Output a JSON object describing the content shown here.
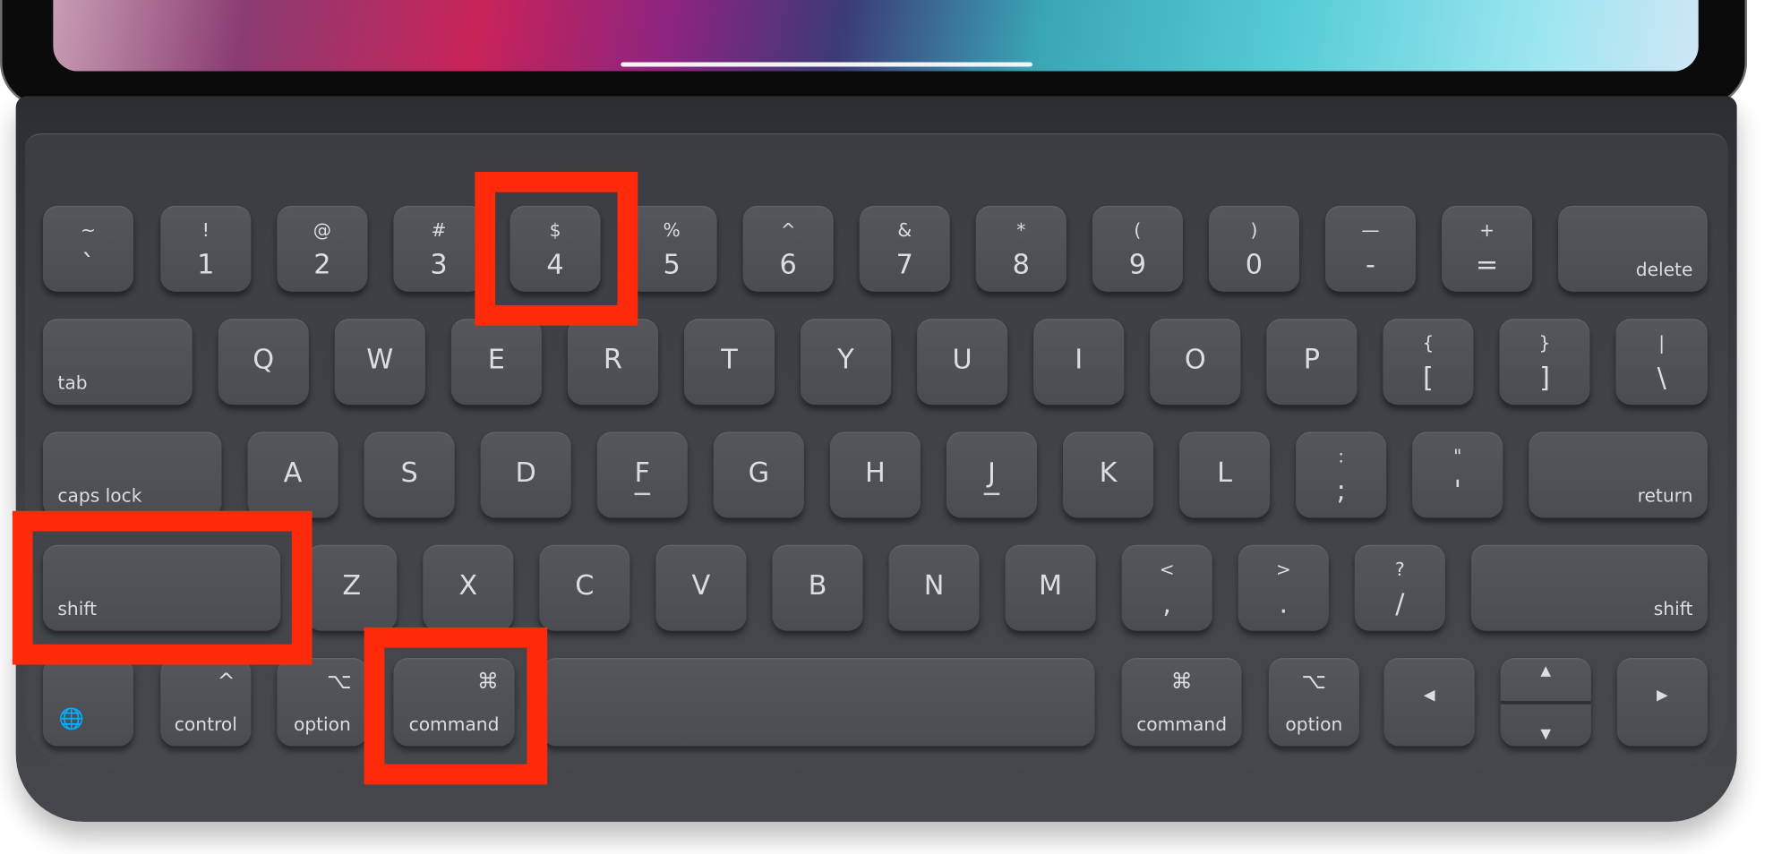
{
  "keyboard": {
    "rows": [
      [
        {
          "top": "~",
          "bot": "`"
        },
        {
          "top": "!",
          "bot": "1"
        },
        {
          "top": "@",
          "bot": "2"
        },
        {
          "top": "#",
          "bot": "3"
        },
        {
          "top": "$",
          "bot": "4"
        },
        {
          "top": "%",
          "bot": "5"
        },
        {
          "top": "^",
          "bot": "6"
        },
        {
          "top": "&",
          "bot": "7"
        },
        {
          "top": "*",
          "bot": "8"
        },
        {
          "top": "(",
          "bot": "9"
        },
        {
          "top": ")",
          "bot": "0"
        },
        {
          "top": "—",
          "bot": "-"
        },
        {
          "top": "+",
          "bot": "="
        },
        {
          "word_right": "delete"
        }
      ],
      [
        {
          "word_left": "tab"
        },
        {
          "single": "Q"
        },
        {
          "single": "W"
        },
        {
          "single": "E"
        },
        {
          "single": "R"
        },
        {
          "single": "T"
        },
        {
          "single": "Y"
        },
        {
          "single": "U"
        },
        {
          "single": "I"
        },
        {
          "single": "O"
        },
        {
          "single": "P"
        },
        {
          "top": "{",
          "bot": "["
        },
        {
          "top": "}",
          "bot": "]"
        },
        {
          "top": "|",
          "bot": "\\"
        }
      ],
      [
        {
          "word_left": "caps lock"
        },
        {
          "single": "A"
        },
        {
          "single": "S"
        },
        {
          "single": "D"
        },
        {
          "single": "F",
          "underline": true
        },
        {
          "single": "G"
        },
        {
          "single": "H"
        },
        {
          "single": "J",
          "underline": true
        },
        {
          "single": "K"
        },
        {
          "single": "L"
        },
        {
          "top": ":",
          "bot": ";"
        },
        {
          "top": "\"",
          "bot": "'"
        },
        {
          "word_right": "return"
        }
      ],
      [
        {
          "word_left": "shift"
        },
        {
          "single": "Z"
        },
        {
          "single": "X"
        },
        {
          "single": "C"
        },
        {
          "single": "V"
        },
        {
          "single": "B"
        },
        {
          "single": "N"
        },
        {
          "single": "M"
        },
        {
          "top": "<",
          "bot": ","
        },
        {
          "top": ">",
          "bot": "."
        },
        {
          "top": "?",
          "bot": "/"
        },
        {
          "word_right": "shift"
        }
      ],
      [
        {
          "globe": "🌐",
          "icon": "globe-icon"
        },
        {
          "mod": "control",
          "sym": "^",
          "icon": "control-icon"
        },
        {
          "mod": "option",
          "sym": "⌥",
          "icon": "option-icon"
        },
        {
          "mod": "command",
          "sym": "⌘",
          "icon": "command-icon"
        },
        {
          "space": true
        },
        {
          "mod": "command",
          "symc": "⌘",
          "icon": "command-icon"
        },
        {
          "mod": "option",
          "symc": "⌥",
          "icon": "option-icon"
        },
        {
          "ctr": "◀",
          "icon": "left-arrow-icon"
        },
        {
          "updown": [
            "▲",
            "▼"
          ]
        },
        {
          "ctr": "▶",
          "icon": "right-arrow-icon"
        }
      ]
    ]
  },
  "highlights": [
    "4",
    "shift",
    "command"
  ],
  "highlight_color": "#ff2a0a"
}
